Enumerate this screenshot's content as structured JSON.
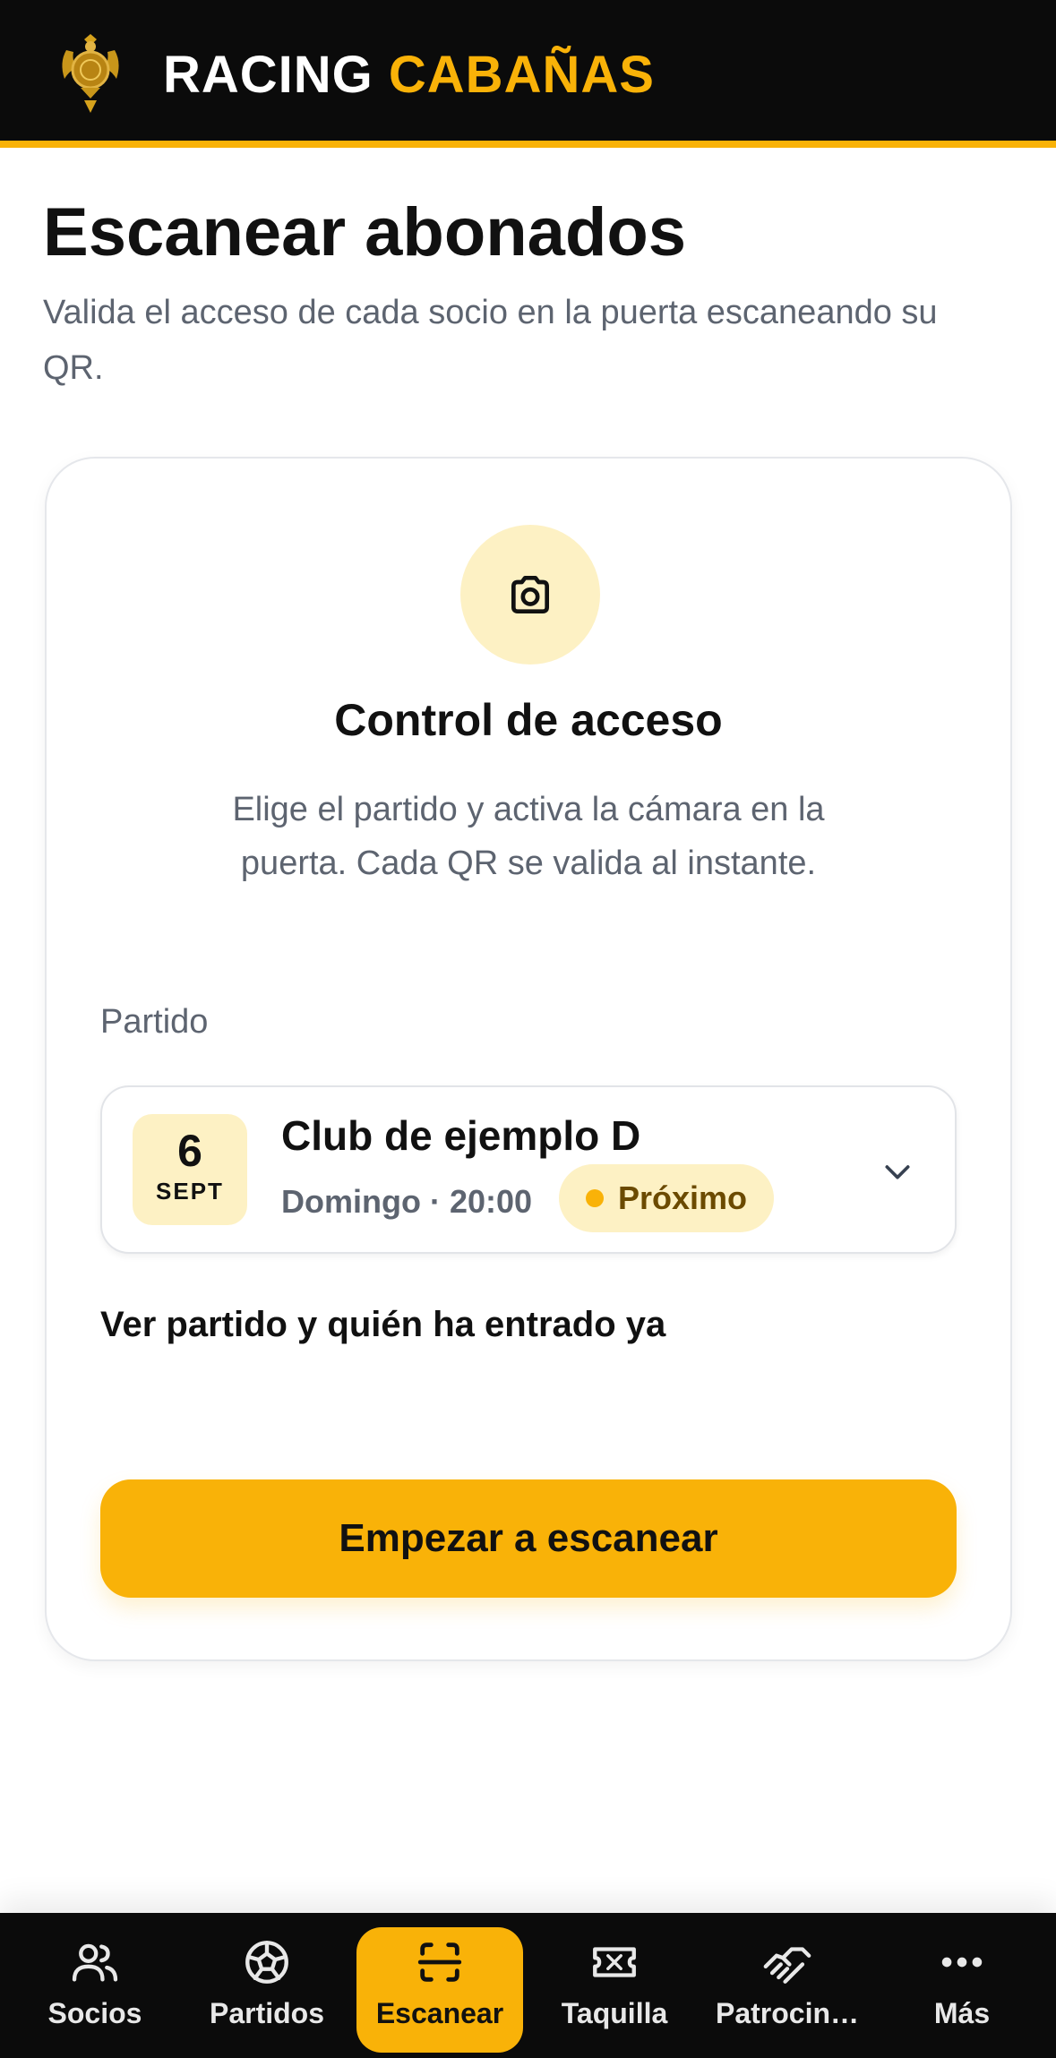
{
  "header": {
    "brand_part1": "RACING",
    "brand_part2": "CABAÑAS",
    "crest_icon": "club-crest-icon"
  },
  "page": {
    "title": "Escanear abonados",
    "subtitle": "Valida el acceso de cada socio en la puerta escaneando su QR."
  },
  "card": {
    "icon": "camera-icon",
    "title": "Control de acceso",
    "description": "Elige el partido y activa la cámara en la puerta. Cada QR se valida al instante.",
    "field_label": "Partido",
    "selected_match": {
      "day": "6",
      "month": "SEPT",
      "name": "Club de ejemplo D",
      "time": "Domingo · 20:00",
      "status": "Próximo"
    },
    "match_link": "Ver partido y quién ha entrado ya",
    "start_button": "Empezar a escanear"
  },
  "nav": {
    "items": [
      {
        "label": "Socios",
        "icon": "users-icon"
      },
      {
        "label": "Partidos",
        "icon": "football-icon"
      },
      {
        "label": "Escanear",
        "icon": "scan-icon",
        "active": true
      },
      {
        "label": "Taquilla",
        "icon": "ticket-icon"
      },
      {
        "label": "Patrocin…",
        "icon": "handshake-icon"
      },
      {
        "label": "Más",
        "icon": "more-icon"
      }
    ]
  },
  "colors": {
    "accent": "#f9b208",
    "accent_soft": "#fdf1c4",
    "dark": "#0b0b0b",
    "muted_text": "#5d6470"
  }
}
